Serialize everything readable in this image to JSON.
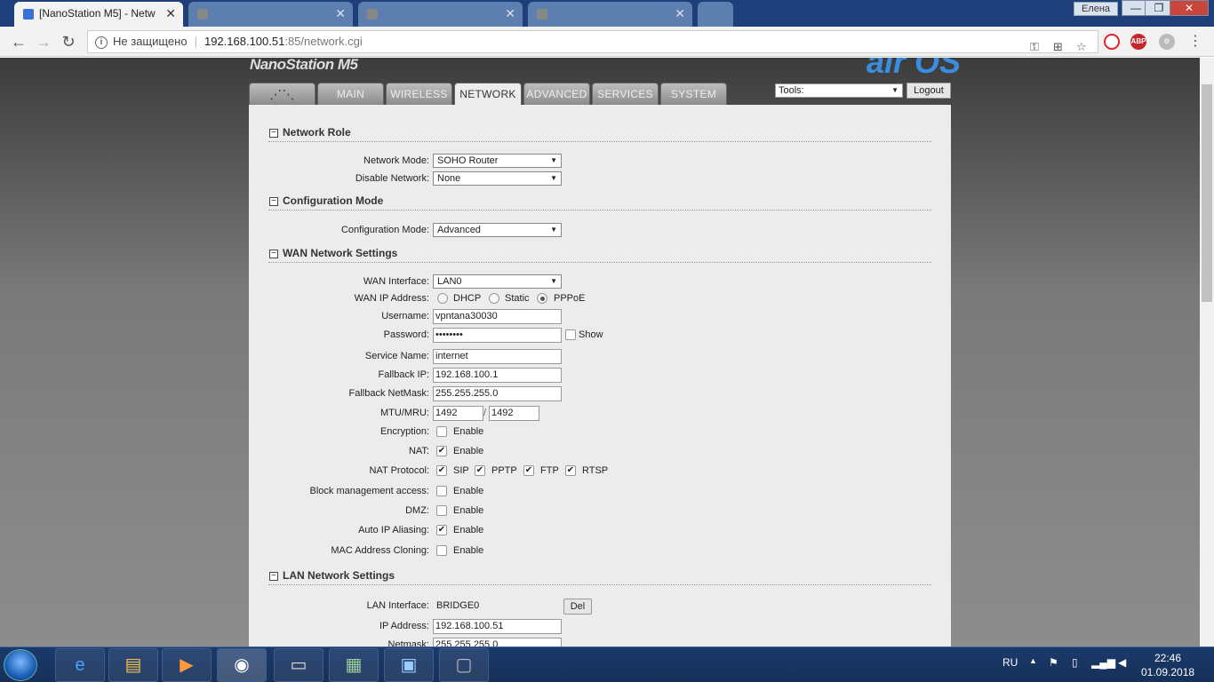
{
  "browser": {
    "tabs": [
      {
        "title": "[NanoStation M5] - Netw",
        "active": true
      },
      {
        "title": "...",
        "active": false
      },
      {
        "title": "...",
        "active": false
      },
      {
        "title": "...",
        "active": false
      }
    ],
    "window_user": "Елена",
    "security_label": "Не защищено",
    "url_host": "192.168.100.51",
    "url_path": ":85/network.cgi"
  },
  "header": {
    "brand": "NanoStation M5",
    "brand_os": "air OS",
    "tabs": [
      "MAIN",
      "WIRELESS",
      "NETWORK",
      "ADVANCED",
      "SERVICES",
      "SYSTEM"
    ],
    "active_tab": "NETWORK",
    "tools_value": "Tools:",
    "logout_label": "Logout"
  },
  "network_role": {
    "title": "Network Role",
    "network_mode_label": "Network Mode:",
    "network_mode_value": "SOHO Router",
    "disable_network_label": "Disable Network:",
    "disable_network_value": "None"
  },
  "config_mode": {
    "title": "Configuration Mode",
    "label": "Configuration Mode:",
    "value": "Advanced"
  },
  "wan": {
    "title": "WAN Network Settings",
    "interface_label": "WAN Interface:",
    "interface_value": "LAN0",
    "ip_address_label": "WAN IP Address:",
    "ip_options": [
      "DHCP",
      "Static",
      "PPPoE"
    ],
    "ip_selected": "PPPoE",
    "username_label": "Username:",
    "username_value": "vpntana30030",
    "password_label": "Password:",
    "password_value": "••••••••",
    "show_label": "Show",
    "service_name_label": "Service Name:",
    "service_name_value": "internet",
    "fallback_ip_label": "Fallback IP:",
    "fallback_ip_value": "192.168.100.1",
    "fallback_mask_label": "Fallback NetMask:",
    "fallback_mask_value": "255.255.255.0",
    "mtu_label": "MTU/MRU:",
    "mtu_value": "1492",
    "mru_value": "1492",
    "mtu_sep": "/",
    "encryption_label": "Encryption:",
    "nat_label": "NAT:",
    "nat_protocol_label": "NAT Protocol:",
    "nat_protocols": [
      "SIP",
      "PPTP",
      "FTP",
      "RTSP"
    ],
    "block_mgmt_label": "Block management access:",
    "dmz_label": "DMZ:",
    "auto_ip_label": "Auto IP Aliasing:",
    "mac_clone_label": "MAC Address Cloning:",
    "enable_label": "Enable"
  },
  "lan": {
    "title": "LAN Network Settings",
    "interface_label": "LAN Interface:",
    "interface_value": "BRIDGE0",
    "del_label": "Del",
    "ip_label": "IP Address:",
    "ip_value": "192.168.100.51",
    "netmask_label": "Netmask:",
    "netmask_value": "255.255.255.0"
  },
  "taskbar": {
    "lang": "RU",
    "time": "22:46",
    "date": "01.09.2018"
  }
}
